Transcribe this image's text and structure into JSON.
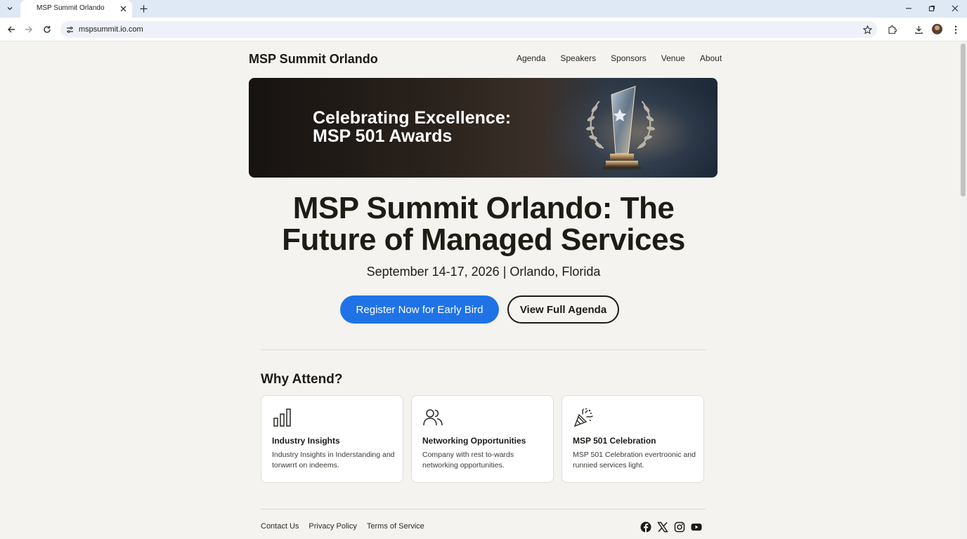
{
  "browser": {
    "tab_title": "MSP Summit Orlando",
    "url": "mspsummit.io.com"
  },
  "site": {
    "brand": "MSP Summit Orlando",
    "nav": [
      "Agenda",
      "Speakers",
      "Sponsors",
      "Venue",
      "About"
    ]
  },
  "banner": {
    "line1": "Celebrating Excellence:",
    "line2": "MSP 501 Awards"
  },
  "hero": {
    "title_line1": "MSP Summit Orlando: The",
    "title_line2": "Future of Managed Services",
    "subtitle": "September 14-17, 2026 | Orlando, Florida",
    "primary_cta": "Register Now for Early Bird",
    "secondary_cta": "View Full Agenda",
    "primary_color": "#1f73e6"
  },
  "why_attend": {
    "title": "Why Attend?",
    "cards": [
      {
        "icon": "bar-chart-icon",
        "title": "Industry Insights",
        "text": "Industry Insights in Inderstanding and torwиrrt on indeems."
      },
      {
        "icon": "people-icon",
        "title": "Networking Opportunities",
        "text": "Company with rest to-wards networking opportunities."
      },
      {
        "icon": "party-popper-icon",
        "title": "MSP 501 Celebration",
        "text": "MSP 501 Celebration evertroonic and runnied services light."
      }
    ]
  },
  "footer": {
    "links": [
      "Contact Us",
      "Privacy Policy",
      "Terms of Service"
    ],
    "social": [
      "facebook-icon",
      "x-icon",
      "instagram-icon",
      "youtube-icon"
    ]
  }
}
